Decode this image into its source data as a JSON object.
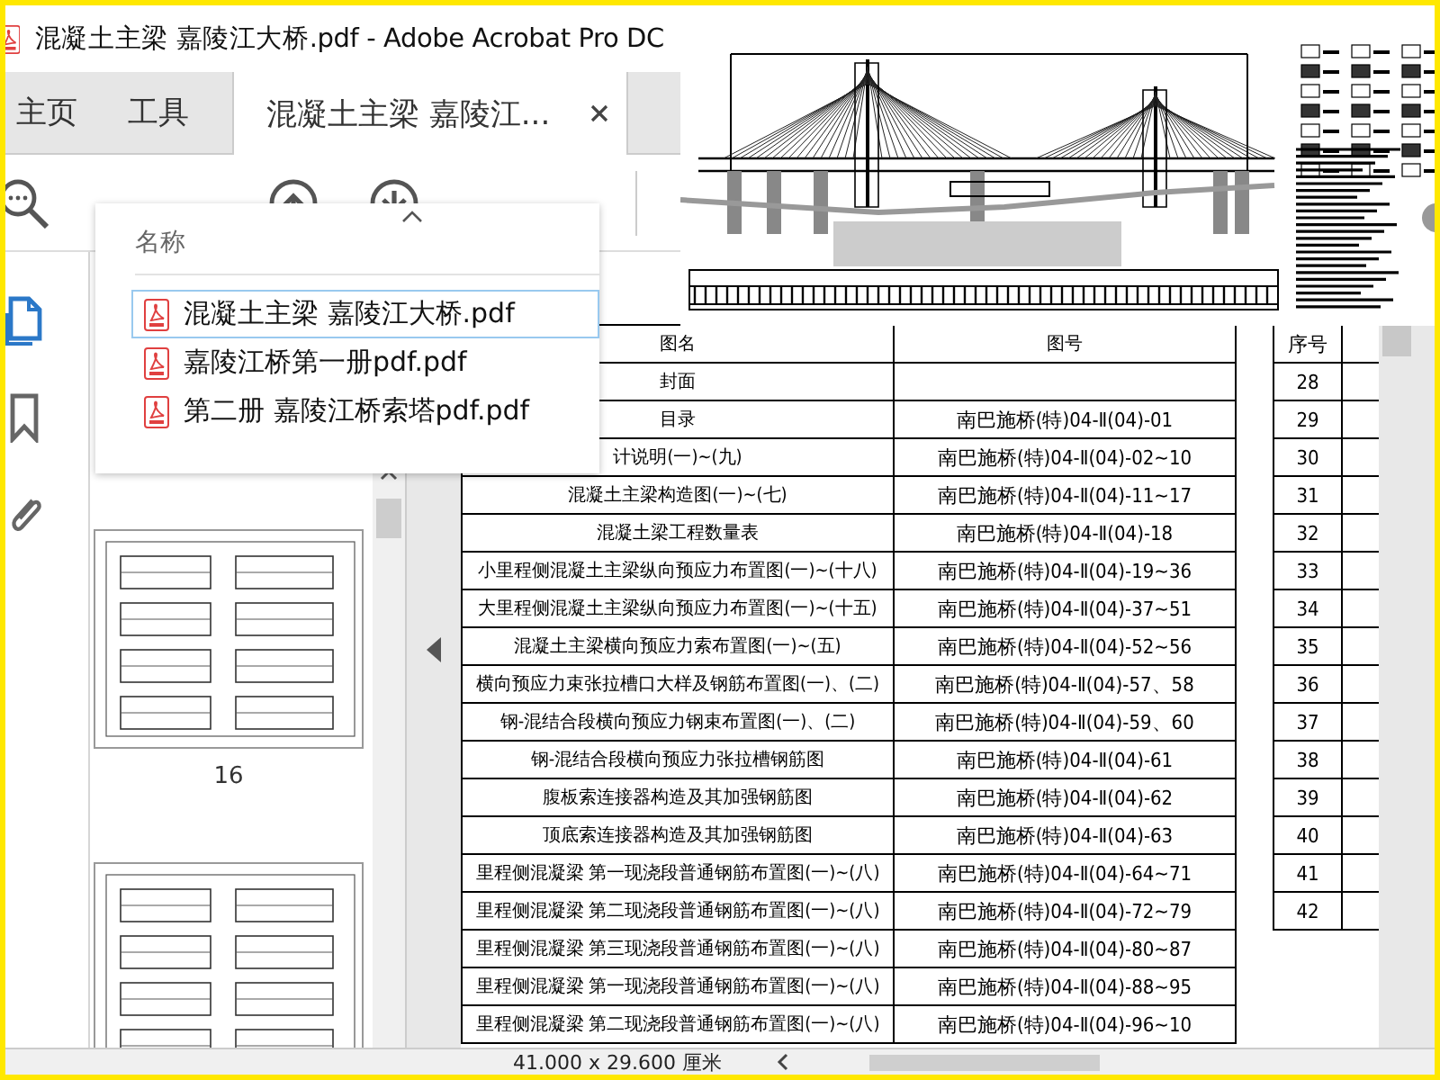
{
  "window": {
    "title": "混凝土主梁 嘉陵江大桥.pdf - Adobe Acrobat Pro DC"
  },
  "tabs": [
    {
      "label": "主页",
      "selected": false
    },
    {
      "label": "工具",
      "selected": false
    },
    {
      "label": "混凝土主梁 嘉陵江...",
      "selected": true
    }
  ],
  "nav_panel": [
    {
      "kind": "pages",
      "selected": true
    },
    {
      "kind": "bookmarks",
      "selected": false
    },
    {
      "kind": "attachments",
      "selected": false
    }
  ],
  "file_menu": {
    "header": "名称",
    "items": [
      {
        "label": "混凝土主梁 嘉陵江大桥.pdf",
        "selected": true
      },
      {
        "label": "嘉陵江桥第一册pdf.pdf",
        "selected": false
      },
      {
        "label": "第二册 嘉陵江桥索塔pdf.pdf",
        "selected": false
      }
    ]
  },
  "thumbnails": [
    {
      "label": "16"
    }
  ],
  "table": {
    "columns": [
      "图名",
      "图号"
    ],
    "rows": [
      [
        "封面",
        ""
      ],
      [
        "目录",
        "南巴施桥(特)04-Ⅱ(04)-01"
      ],
      [
        "计说明(一)~(九)",
        "南巴施桥(特)04-Ⅱ(04)-02~10"
      ],
      [
        "混凝土主梁构造图(一)~(七)",
        "南巴施桥(特)04-Ⅱ(04)-11~17"
      ],
      [
        "混凝土梁工程数量表",
        "南巴施桥(特)04-Ⅱ(04)-18"
      ],
      [
        "小里程侧混凝土主梁纵向预应力布置图(一)~(十八)",
        "南巴施桥(特)04-Ⅱ(04)-19~36"
      ],
      [
        "大里程侧混凝土主梁纵向预应力布置图(一)~(十五)",
        "南巴施桥(特)04-Ⅱ(04)-37~51"
      ],
      [
        "混凝土主梁横向预应力索布置图(一)~(五)",
        "南巴施桥(特)04-Ⅱ(04)-52~56"
      ],
      [
        "横向预应力束张拉槽口大样及钢筋布置图(一)、(二)",
        "南巴施桥(特)04-Ⅱ(04)-57、58"
      ],
      [
        "钢-混结合段横向预应力钢束布置图(一)、(二)",
        "南巴施桥(特)04-Ⅱ(04)-59、60"
      ],
      [
        "钢-混结合段横向预应力张拉槽钢筋图",
        "南巴施桥(特)04-Ⅱ(04)-61"
      ],
      [
        "腹板索连接器构造及其加强钢筋图",
        "南巴施桥(特)04-Ⅱ(04)-62"
      ],
      [
        "顶底索连接器构造及其加强钢筋图",
        "南巴施桥(特)04-Ⅱ(04)-63"
      ],
      [
        "里程侧混凝梁 第一现浇段普通钢筋布置图(一)~(八)",
        "南巴施桥(特)04-Ⅱ(04)-64~71"
      ],
      [
        "里程侧混凝梁 第二现浇段普通钢筋布置图(一)~(八)",
        "南巴施桥(特)04-Ⅱ(04)-72~79"
      ],
      [
        "里程侧混凝梁 第三现浇段普通钢筋布置图(一)~(八)",
        "南巴施桥(特)04-Ⅱ(04)-80~87"
      ],
      [
        "里程侧混凝梁 第一现浇段普通钢筋布置图(一)~(八)",
        "南巴施桥(特)04-Ⅱ(04)-88~95"
      ],
      [
        "里程侧混凝梁 第二现浇段普通钢筋布置图(一)~(八)",
        "南巴施桥(特)04-Ⅱ(04)-96~10"
      ]
    ]
  },
  "index_table": {
    "column": "序号",
    "rows": [
      "28",
      "29",
      "30",
      "31",
      "32",
      "33",
      "34",
      "35",
      "36",
      "37",
      "38",
      "39",
      "40",
      "41",
      "42"
    ]
  },
  "status_bar": {
    "page_size": "41.000 x 29.600 厘米"
  }
}
